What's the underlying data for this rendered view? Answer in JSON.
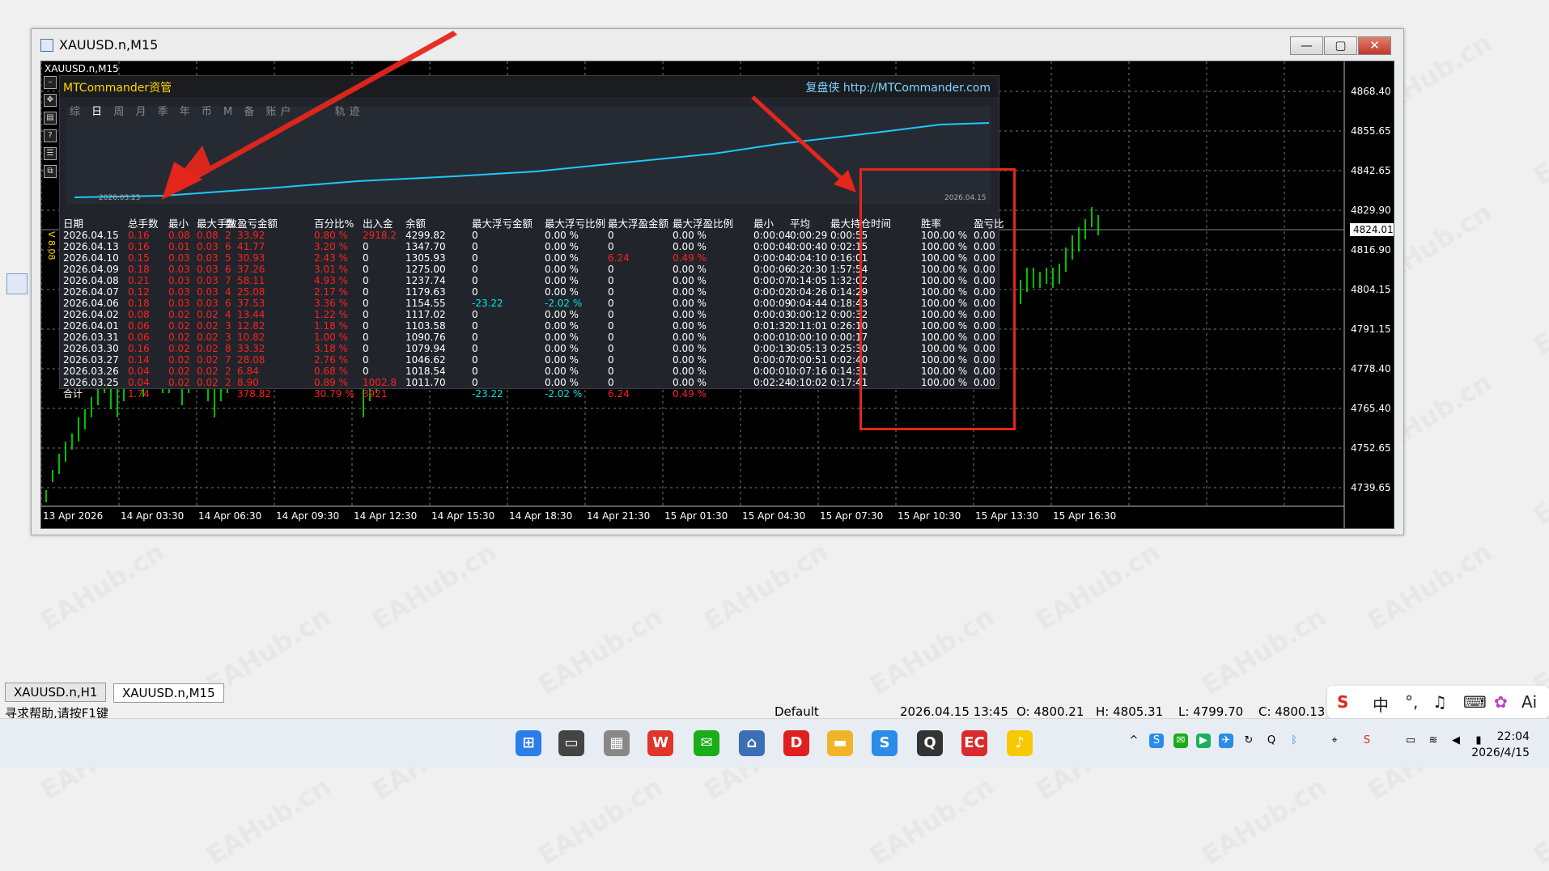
{
  "window": {
    "title": "XAUUSD.n,M15",
    "min": "—",
    "max": "▢",
    "close": "✕"
  },
  "chart": {
    "symbol_label": "XAUUSD.n,M15",
    "version_label": "V 8.08",
    "current_price": "4824.01",
    "price_axis": [
      "4868.40",
      "4855.65",
      "4842.65",
      "4829.90",
      "4816.90",
      "4804.15",
      "4791.15",
      "4778.40",
      "4765.40",
      "4752.65",
      "4739.65"
    ],
    "time_axis": [
      "13 Apr 2026",
      "14 Apr 03:30",
      "14 Apr 06:30",
      "14 Apr 09:30",
      "14 Apr 12:30",
      "14 Apr 15:30",
      "14 Apr 18:30",
      "14 Apr 21:30",
      "15 Apr 01:30",
      "15 Apr 04:30",
      "15 Apr 07:30",
      "15 Apr 10:30",
      "15 Apr 13:30",
      "15 Apr 16:30"
    ]
  },
  "panel": {
    "name": "MTCommander资管",
    "right_label": "复盘侠 http://MTCommander.com",
    "tabs_a": "综",
    "tabs_active": "日",
    "tabs_b": "周 月 季 年 币 M 备 账户",
    "tabs_c": "轨迹",
    "graph_start": "2026.03.25",
    "graph_end": "2026.04.15",
    "headers": [
      "日期",
      "总手数",
      "最小",
      "最大手数",
      "数",
      "盈亏金额",
      "百分比%",
      "出入金",
      "余额",
      "最大浮亏金额",
      "最大浮亏比例",
      "最大浮盈金额",
      "最大浮盈比例",
      "最小",
      "平均",
      "最大持仓时间",
      "胜率",
      "盈亏比"
    ],
    "rows": [
      [
        "2026.04.15",
        "0.16",
        "0.08",
        "0.08",
        "2",
        "33.92",
        "0.80 %",
        "2918.2",
        "4299.82",
        "0",
        "0.00 %",
        "0",
        "0.00 %",
        "0:00:04",
        "0:00:29",
        "0:00:55",
        "100.00 %",
        "0.00"
      ],
      [
        "2026.04.13",
        "0.16",
        "0.01",
        "0.03",
        "6",
        "41.77",
        "3.20 %",
        "0",
        "1347.70",
        "0",
        "0.00 %",
        "0",
        "0.00 %",
        "0:00:04",
        "0:00:40",
        "0:02:15",
        "100.00 %",
        "0.00"
      ],
      [
        "2026.04.10",
        "0.15",
        "0.03",
        "0.03",
        "5",
        "30.93",
        "2.43 %",
        "0",
        "1305.93",
        "0",
        "0.00 %",
        "6.24",
        "0.49 %",
        "0:00:04",
        "0:04:10",
        "0:16:01",
        "100.00 %",
        "0.00"
      ],
      [
        "2026.04.09",
        "0.18",
        "0.03",
        "0.03",
        "6",
        "37.26",
        "3.01 %",
        "0",
        "1275.00",
        "0",
        "0.00 %",
        "0",
        "0.00 %",
        "0:00:06",
        "0:20:30",
        "1:57:54",
        "100.00 %",
        "0.00"
      ],
      [
        "2026.04.08",
        "0.21",
        "0.03",
        "0.03",
        "7",
        "58.11",
        "4.93 %",
        "0",
        "1237.74",
        "0",
        "0.00 %",
        "0",
        "0.00 %",
        "0:00:07",
        "0:14:05",
        "1:32:02",
        "100.00 %",
        "0.00"
      ],
      [
        "2026.04.07",
        "0.12",
        "0.03",
        "0.03",
        "4",
        "25.08",
        "2.17 %",
        "0",
        "1179.63",
        "0",
        "0.00 %",
        "0",
        "0.00 %",
        "0:00:02",
        "0:04:26",
        "0:14:29",
        "100.00 %",
        "0.00"
      ],
      [
        "2026.04.06",
        "0.18",
        "0.03",
        "0.03",
        "6",
        "37.53",
        "3.36 %",
        "0",
        "1154.55",
        "-23.22",
        "-2.02 %",
        "0",
        "0.00 %",
        "0:00:09",
        "0:04:44",
        "0:18:43",
        "100.00 %",
        "0.00"
      ],
      [
        "2026.04.02",
        "0.08",
        "0.02",
        "0.02",
        "4",
        "13.44",
        "1.22 %",
        "0",
        "1117.02",
        "0",
        "0.00 %",
        "0",
        "0.00 %",
        "0:00:03",
        "0:00:12",
        "0:00:32",
        "100.00 %",
        "0.00"
      ],
      [
        "2026.04.01",
        "0.06",
        "0.02",
        "0.02",
        "3",
        "12.82",
        "1.18 %",
        "0",
        "1103.58",
        "0",
        "0.00 %",
        "0",
        "0.00 %",
        "0:01:32",
        "0:11:01",
        "0:26:10",
        "100.00 %",
        "0.00"
      ],
      [
        "2026.03.31",
        "0.06",
        "0.02",
        "0.02",
        "3",
        "10.82",
        "1.00 %",
        "0",
        "1090.76",
        "0",
        "0.00 %",
        "0",
        "0.00 %",
        "0:00:01",
        "0:00:10",
        "0:00:17",
        "100.00 %",
        "0.00"
      ],
      [
        "2026.03.30",
        "0.16",
        "0.02",
        "0.02",
        "8",
        "33.32",
        "3.18 %",
        "0",
        "1079.94",
        "0",
        "0.00 %",
        "0",
        "0.00 %",
        "0:00:13",
        "0:05:13",
        "0:25:30",
        "100.00 %",
        "0.00"
      ],
      [
        "2026.03.27",
        "0.14",
        "0.02",
        "0.02",
        "7",
        "28.08",
        "2.76 %",
        "0",
        "1046.62",
        "0",
        "0.00 %",
        "0",
        "0.00 %",
        "0:00:07",
        "0:00:51",
        "0:02:40",
        "100.00 %",
        "0.00"
      ],
      [
        "2026.03.26",
        "0.04",
        "0.02",
        "0.02",
        "2",
        "6.84",
        "0.68 %",
        "0",
        "1018.54",
        "0",
        "0.00 %",
        "0",
        "0.00 %",
        "0:00:01",
        "0:07:16",
        "0:14:31",
        "100.00 %",
        "0.00"
      ],
      [
        "2026.03.25",
        "0.04",
        "0.02",
        "0.02",
        "2",
        "8.90",
        "0.89 %",
        "1002.8",
        "1011.70",
        "0",
        "0.00 %",
        "0",
        "0.00 %",
        "0:02:24",
        "0:10:02",
        "0:17:41",
        "100.00 %",
        "0.00"
      ]
    ],
    "total": [
      "合计",
      "1.74",
      "",
      "",
      "",
      "378.82",
      "30.79 %",
      "3921",
      "",
      "-23.22",
      "-2.02 %",
      "6.24",
      "0.49 %",
      "",
      "",
      "",
      "",
      ""
    ]
  },
  "tabs": [
    "XAUUSD.n,H1",
    "XAUUSD.n,M15"
  ],
  "status": {
    "help": "寻求帮助,请按F1键",
    "profile": "Default",
    "datetime": "2026.04.15 13:45",
    "open": "O: 4800.21",
    "high": "H: 4805.31",
    "low": "L: 4799.70",
    "close": "C: 4800.13"
  },
  "ime": {
    "lang": "中"
  },
  "clock": {
    "time": "22:04",
    "date": "2026/4/15"
  },
  "watermark": "EAHub.cn",
  "colors": {
    "up_bar": "#00ff00",
    "equity_line": "#1fc7ff",
    "highlight": "#e4261b"
  }
}
